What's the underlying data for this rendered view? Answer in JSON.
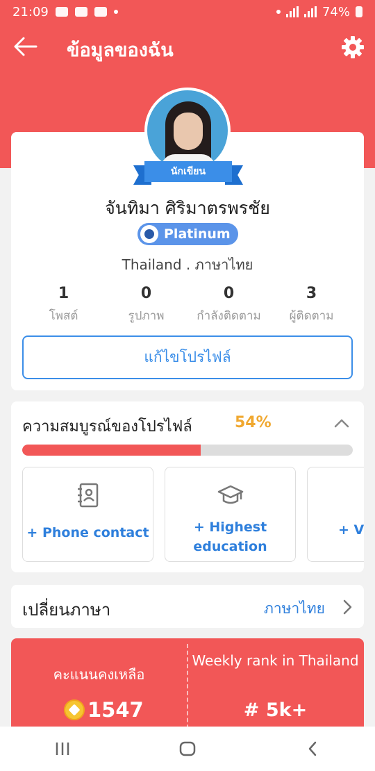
{
  "status_bar": {
    "time": "21:09",
    "battery": "74%"
  },
  "header": {
    "title": "ข้อมูลของฉัน",
    "back_icon": "arrow-left-icon",
    "settings_icon": "gear-icon"
  },
  "profile": {
    "ribbon_label": "นักเขียน",
    "name": "จันทิมา ศิริมาตรพรชัย",
    "badge": "Platinum",
    "location": "Thailand . ภาษาไทย",
    "stats": [
      {
        "value": "1",
        "label": "โพสต์"
      },
      {
        "value": "0",
        "label": "รูปภาพ"
      },
      {
        "value": "0",
        "label": "กำลังติดตาม"
      },
      {
        "value": "3",
        "label": "ผู้ติดตาม"
      }
    ],
    "edit_button": "แก้ไขโปรไฟล์"
  },
  "completeness": {
    "title": "ความสมบูรณ์ของโปรไฟล์",
    "percent_label": "54%",
    "percent": 54,
    "tasks": [
      {
        "label": "+ Phone contact",
        "icon": "contact-book-icon"
      },
      {
        "label": "+ Highest education",
        "icon": "graduation-cap-icon"
      },
      {
        "label": "+ V"
      }
    ]
  },
  "language": {
    "label": "เปลี่ยนภาษา",
    "value": "ภาษาไทย"
  },
  "points": {
    "label": "คะแนนคงเหลือ",
    "value": "1547",
    "rank_label": "Weekly rank in Thailand",
    "rank_value": "# 5k+"
  },
  "colors": {
    "primary": "#f25757",
    "accent_blue": "#3b8ee8",
    "percent_orange": "#f0a830"
  }
}
